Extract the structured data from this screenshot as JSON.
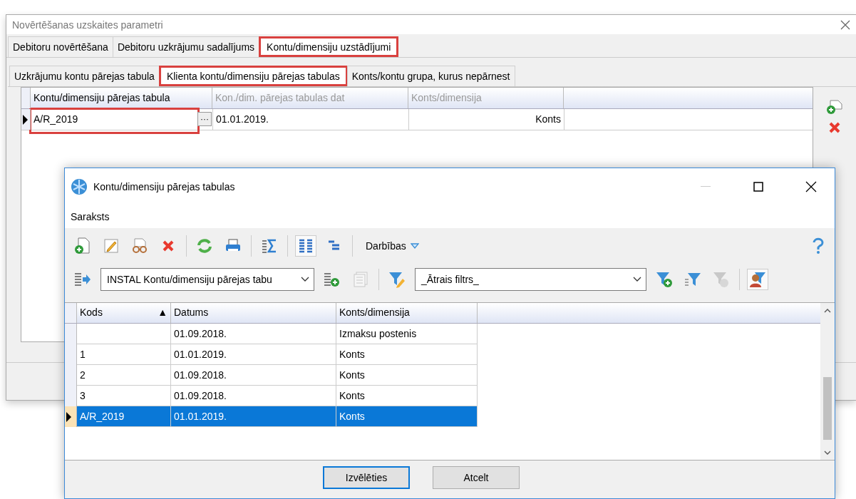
{
  "window": {
    "title": "Novērtēšanas uzskaites parametri"
  },
  "tabs": [
    {
      "label": "Debitoru novērtēšana",
      "selected": false,
      "highlighted": false
    },
    {
      "label": "Debitoru uzkrājumu sadalījums",
      "selected": false,
      "highlighted": false
    },
    {
      "label": "Kontu/dimensiju uzstādījumi",
      "selected": true,
      "highlighted": true
    }
  ],
  "subtabs": [
    {
      "label": "Uzkrājumu kontu pārejas tabula",
      "selected": false,
      "highlighted": false
    },
    {
      "label": "Klienta kontu/dimensiju pārejas tabulas",
      "selected": true,
      "highlighted": true
    },
    {
      "label": "Konts/kontu grupa, kurus nepārnest",
      "selected": false,
      "highlighted": false
    }
  ],
  "grid": {
    "columns": [
      {
        "label": "Kontu/dimensiju pārejas tabula",
        "disabled": false
      },
      {
        "label": "Kon./dim. pārejas tabulas dat",
        "disabled": true
      },
      {
        "label": "Konts/dimensija",
        "disabled": true
      }
    ],
    "rows": [
      {
        "current": true,
        "cells": [
          {
            "text": "A/R_2019",
            "highlighted": true,
            "button": "···"
          },
          {
            "text": "01.01.2019.",
            "highlighted": false
          },
          {
            "text": "Konts",
            "highlighted": false
          }
        ]
      }
    ]
  },
  "dialog": {
    "title": "Kontu/dimensiju pārejas tabulas",
    "menu": [
      {
        "label": "Saraksts"
      }
    ],
    "toolbar": {
      "items": [
        {
          "kind": "button",
          "pressed": false,
          "disabled": false
        },
        {
          "kind": "button",
          "pressed": false,
          "disabled": false
        },
        {
          "kind": "button",
          "pressed": false,
          "disabled": false
        },
        {
          "kind": "button",
          "pressed": false,
          "disabled": false
        },
        {
          "kind": "separator"
        },
        {
          "kind": "button",
          "pressed": false,
          "disabled": false
        },
        {
          "kind": "button",
          "pressed": false,
          "disabled": false
        },
        {
          "kind": "separator"
        },
        {
          "kind": "button",
          "pressed": false,
          "disabled": false
        },
        {
          "kind": "separator"
        },
        {
          "kind": "button",
          "pressed": true,
          "disabled": false
        },
        {
          "kind": "button",
          "pressed": false,
          "disabled": false
        },
        {
          "kind": "separator"
        },
        {
          "kind": "menu",
          "label": "Darbības"
        },
        {
          "kind": "spacer"
        },
        {
          "kind": "button",
          "pressed": false,
          "disabled": false
        }
      ]
    },
    "filterbar": {
      "items": [
        {
          "kind": "button",
          "pressed": false,
          "disabled": false
        },
        {
          "kind": "select",
          "value": "INSTAL Kontu/dimensiju pārejas tabu",
          "wide": false
        },
        {
          "kind": "button",
          "pressed": false,
          "disabled": false
        },
        {
          "kind": "button",
          "pressed": false,
          "disabled": true
        },
        {
          "kind": "separator"
        },
        {
          "kind": "button",
          "pressed": false,
          "disabled": false
        },
        {
          "kind": "select",
          "value": "_Ātrais filtrs_",
          "wide": true
        },
        {
          "kind": "button",
          "pressed": false,
          "disabled": false
        },
        {
          "kind": "button",
          "pressed": false,
          "disabled": false
        },
        {
          "kind": "button",
          "pressed": false,
          "disabled": true
        },
        {
          "kind": "separator"
        },
        {
          "kind": "button",
          "pressed": true,
          "disabled": false
        }
      ]
    },
    "table": {
      "columns": [
        {
          "label": "Kods",
          "sort_mark": "▲"
        },
        {
          "label": "Datums"
        },
        {
          "label": "Konts/dimensija"
        }
      ],
      "rows": [
        {
          "selected": false,
          "cells": [
            "",
            "01.09.2018.",
            "Izmaksu postenis"
          ]
        },
        {
          "selected": false,
          "cells": [
            "1",
            "01.01.2019.",
            "Konts"
          ]
        },
        {
          "selected": false,
          "cells": [
            "2",
            "01.09.2018.",
            "Konts"
          ]
        },
        {
          "selected": false,
          "cells": [
            "3",
            "01.09.2018.",
            "Konts"
          ]
        },
        {
          "selected": true,
          "cells": [
            "A/R_2019",
            "01.01.2019.",
            "Konts"
          ]
        }
      ]
    },
    "buttons": [
      {
        "label": "Izvēlēties",
        "default": true
      },
      {
        "label": "Atcelt",
        "default": false
      }
    ]
  }
}
